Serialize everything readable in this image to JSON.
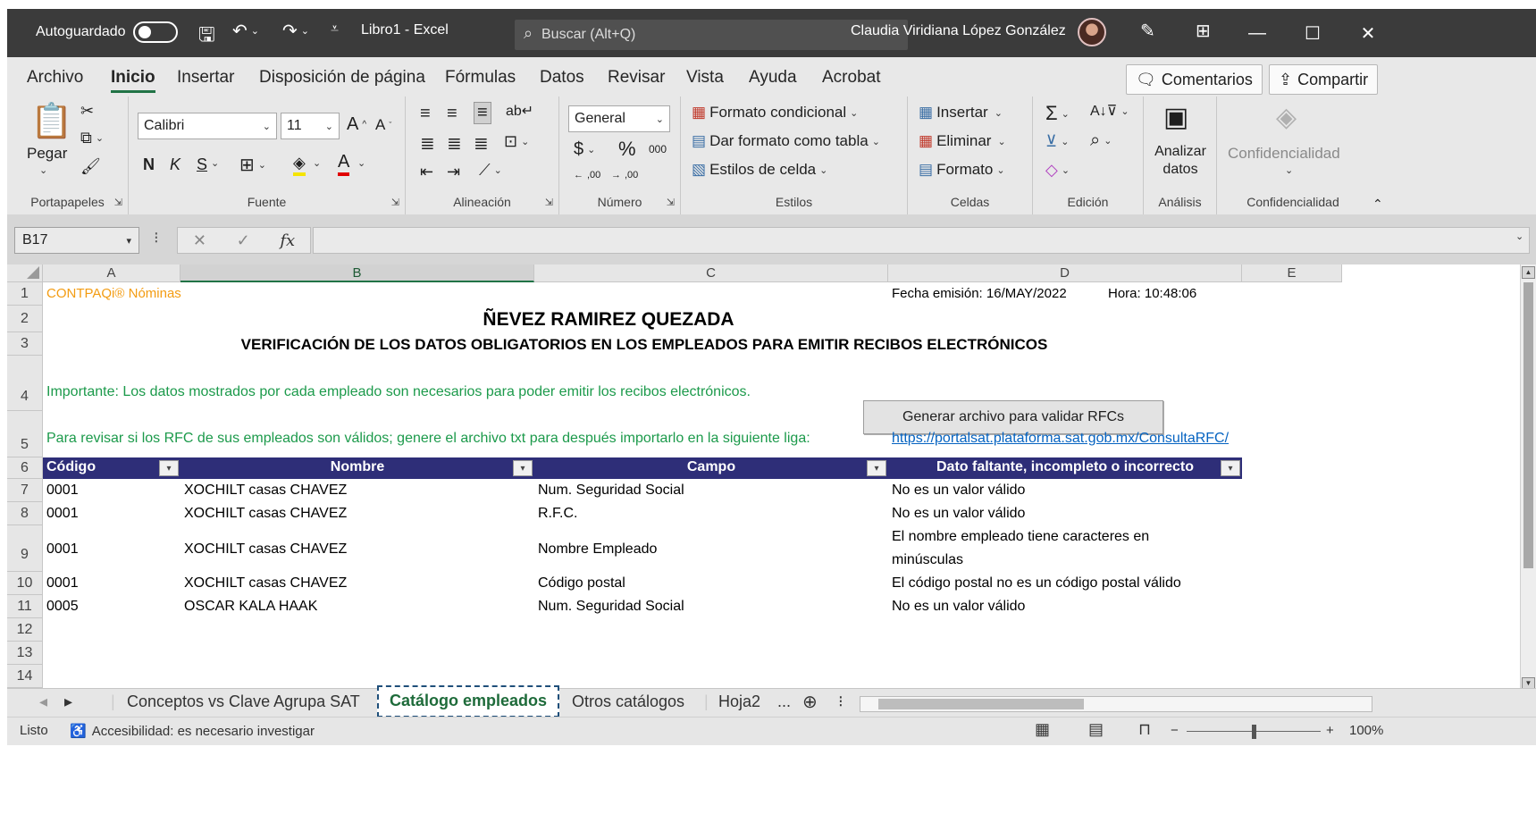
{
  "titlebar": {
    "autosave_label": "Autoguardado",
    "doc_title": "Libro1  -  Excel",
    "search_placeholder": "Buscar (Alt+Q)",
    "user_name": "Claudia Viridiana López González"
  },
  "ribbon": {
    "tabs": [
      "Archivo",
      "Inicio",
      "Insertar",
      "Disposición de página",
      "Fórmulas",
      "Datos",
      "Revisar",
      "Vista",
      "Ayuda",
      "Acrobat"
    ],
    "comments_label": "Comentarios",
    "share_label": "Compartir",
    "clipboard": {
      "paste": "Pegar",
      "label": "Portapapeles"
    },
    "font": {
      "name": "Calibri",
      "size": "11",
      "bold": "N",
      "italic": "K",
      "underline": "S",
      "label": "Fuente"
    },
    "alignment": {
      "label": "Alineación"
    },
    "number": {
      "format": "General",
      "currency": "$",
      "percent": "%",
      "thousands": "000",
      "dec_inc": ",00",
      "dec_dec": ",00",
      "label": "Número"
    },
    "styles": {
      "conditional": "Formato condicional",
      "as_table": "Dar formato como tabla",
      "cell_styles": "Estilos de celda",
      "label": "Estilos"
    },
    "cells": {
      "insert": "Insertar",
      "delete": "Eliminar",
      "format": "Formato",
      "label": "Celdas"
    },
    "editing": {
      "label": "Edición"
    },
    "analysis": {
      "analyze": "Analizar datos",
      "label": "Análisis"
    },
    "sensitivity": {
      "button": "Confidencialidad",
      "label": "Confidencialidad"
    }
  },
  "formula_bar": {
    "name_box": "B17",
    "fx": "fx",
    "value": ""
  },
  "columns": [
    "A",
    "B",
    "C",
    "D",
    "E"
  ],
  "rows": [
    "1",
    "2",
    "3",
    "4",
    "5",
    "6",
    "7",
    "8",
    "9",
    "10",
    "11",
    "12",
    "13",
    "14"
  ],
  "sheet": {
    "brand": "CONTPAQi® Nóminas",
    "issue_date": "Fecha emisión: 16/MAY/2022",
    "issue_time": "Hora: 10:48:06",
    "company": "ÑEVEZ RAMIREZ QUEZADA",
    "report_title": "VERIFICACIÓN DE LOS DATOS OBLIGATORIOS EN LOS EMPLEADOS PARA EMITIR RECIBOS ELECTRÓNICOS",
    "note1": "Importante: Los datos mostrados por cada empleado son necesarios para poder emitir los recibos electrónicos.",
    "generate_button": "Generar archivo para validar RFCs",
    "note2": "Para revisar si los RFC de sus empleados son válidos; genere el archivo txt para después importarlo en la siguiente liga:",
    "link": "https://portalsat.plataforma.sat.gob.mx/ConsultaRFC/",
    "table_headers": [
      "Código",
      "Nombre",
      "Campo",
      "Dato faltante, incompleto o incorrecto"
    ],
    "table_rows": [
      {
        "code": "0001",
        "name": "XOCHILT casas CHAVEZ",
        "field": "Num. Seguridad Social",
        "issue": "No es un valor válido"
      },
      {
        "code": "0001",
        "name": "XOCHILT casas CHAVEZ",
        "field": "R.F.C.",
        "issue": "No es un valor válido"
      },
      {
        "code": "0001",
        "name": "XOCHILT casas CHAVEZ",
        "field": "Nombre Empleado",
        "issue_line1": "El nombre empleado tiene caracteres en",
        "issue_line2": "minúsculas"
      },
      {
        "code": "0001",
        "name": "XOCHILT casas CHAVEZ",
        "field": "Código postal",
        "issue": "El código postal no es un código postal válido"
      },
      {
        "code": "0005",
        "name": "OSCAR KALA HAAK",
        "field": "Num. Seguridad Social",
        "issue": "No es un valor válido"
      }
    ]
  },
  "sheet_tabs": [
    "Conceptos vs Clave Agrupa SAT",
    "Catálogo empleados",
    "Otros catálogos",
    "Hoja2",
    "..."
  ],
  "status": {
    "ready": "Listo",
    "accessibility": "Accesibilidad: es necesario investigar",
    "zoom": "100%"
  }
}
